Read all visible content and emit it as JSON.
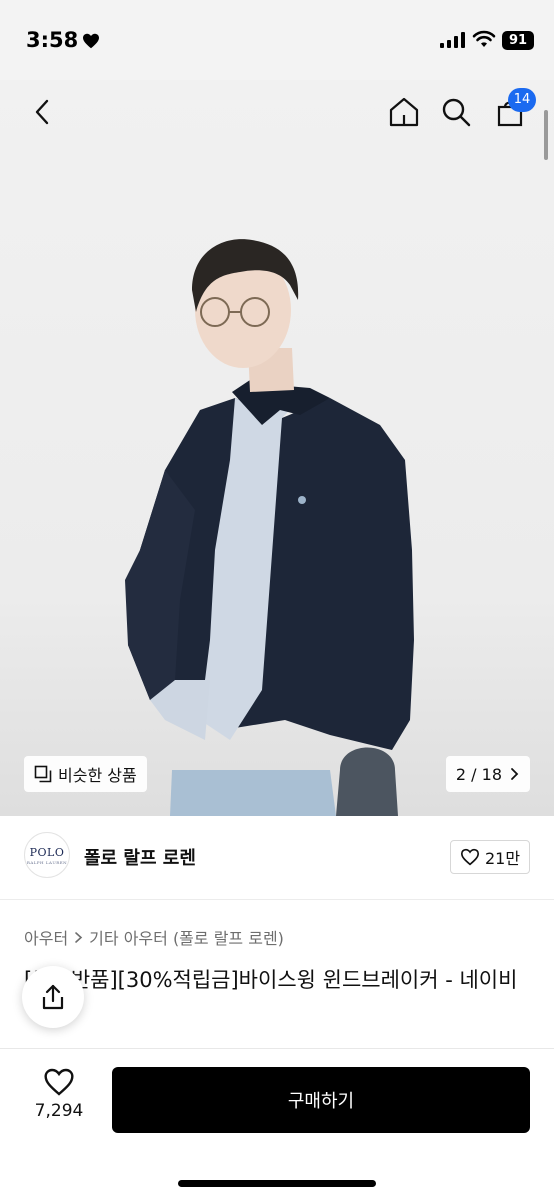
{
  "status_bar": {
    "time": "3:58",
    "battery": "91"
  },
  "nav": {
    "cart_count": "14"
  },
  "hero": {
    "similar_label": "비슷한 상품",
    "counter": "2 / 18"
  },
  "brand": {
    "logo_text": "POLO",
    "logo_sub": "RALPH LAUREN",
    "name": "폴로 랄프 로렌",
    "likes": "21만"
  },
  "breadcrumb": {
    "category": "아우터",
    "subcategory": "기타 아우터 (폴로 랄프 로렌)"
  },
  "product": {
    "title": "[무료반품][30%적립금]바이스윙 윈드브레이커 - 네이비"
  },
  "bottom": {
    "wish_count": "7,294",
    "buy_label": "구매하기"
  },
  "icons": [
    "back-icon",
    "home-icon",
    "search-icon",
    "cart-icon",
    "heart-icon",
    "chevron-right-icon",
    "share-icon",
    "copy-icon"
  ]
}
